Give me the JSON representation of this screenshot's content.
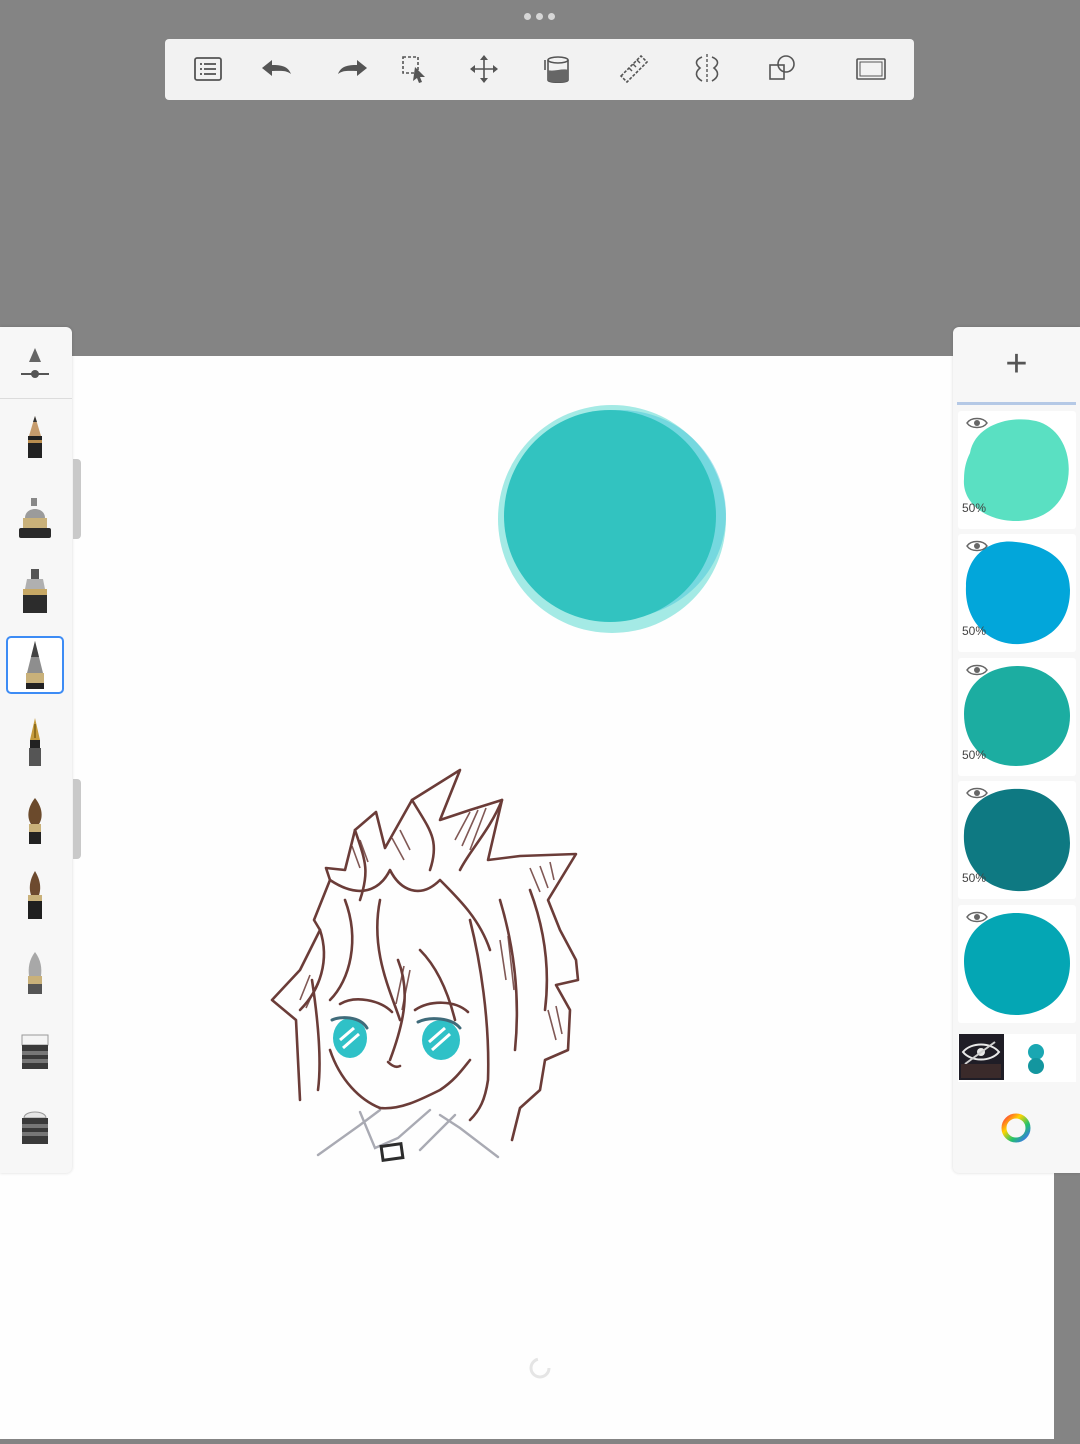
{
  "toolbar": {
    "items": [
      {
        "name": "layer-list-icon",
        "label": "list"
      },
      {
        "name": "undo-icon",
        "label": "undo"
      },
      {
        "name": "redo-icon",
        "label": "redo"
      },
      {
        "name": "selection-icon",
        "label": "select"
      },
      {
        "name": "move-icon",
        "label": "transform"
      },
      {
        "name": "fill-bucket-icon",
        "label": "fill"
      },
      {
        "name": "ruler-icon",
        "label": "ruler"
      },
      {
        "name": "symmetry-icon",
        "label": "symmetry"
      },
      {
        "name": "shapes-icon",
        "label": "shapes"
      },
      {
        "name": "fullscreen-icon",
        "label": "fullscreen"
      }
    ]
  },
  "brushes": {
    "items": [
      "brush-properties-icon",
      "pencil-icon",
      "airbrush-icon",
      "marker-icon",
      "technical-pen-icon",
      "ballpoint-pen-icon",
      "paint-brush-icon",
      "ink-brush-icon",
      "smudge-icon",
      "eraser-icon",
      "soft-eraser-icon"
    ],
    "selected_index": 4
  },
  "layers": {
    "add_label": "+",
    "items": [
      {
        "color": "#5ae0c2",
        "opacity_label": "50%"
      },
      {
        "color": "#02a6da",
        "opacity_label": "50%"
      },
      {
        "color": "#1cada1",
        "opacity_label": "50%"
      },
      {
        "color": "#0e7982",
        "opacity_label": "50%"
      },
      {
        "color": "#04a6b4",
        "opacity_label": ""
      }
    ]
  },
  "colors": {
    "canvas_bg": "#fefefe",
    "app_bg": "#848484",
    "selection_accent": "#3d8cf5",
    "sketch_stroke": "#6b3c38",
    "circle_fill": "#32c3c0"
  }
}
